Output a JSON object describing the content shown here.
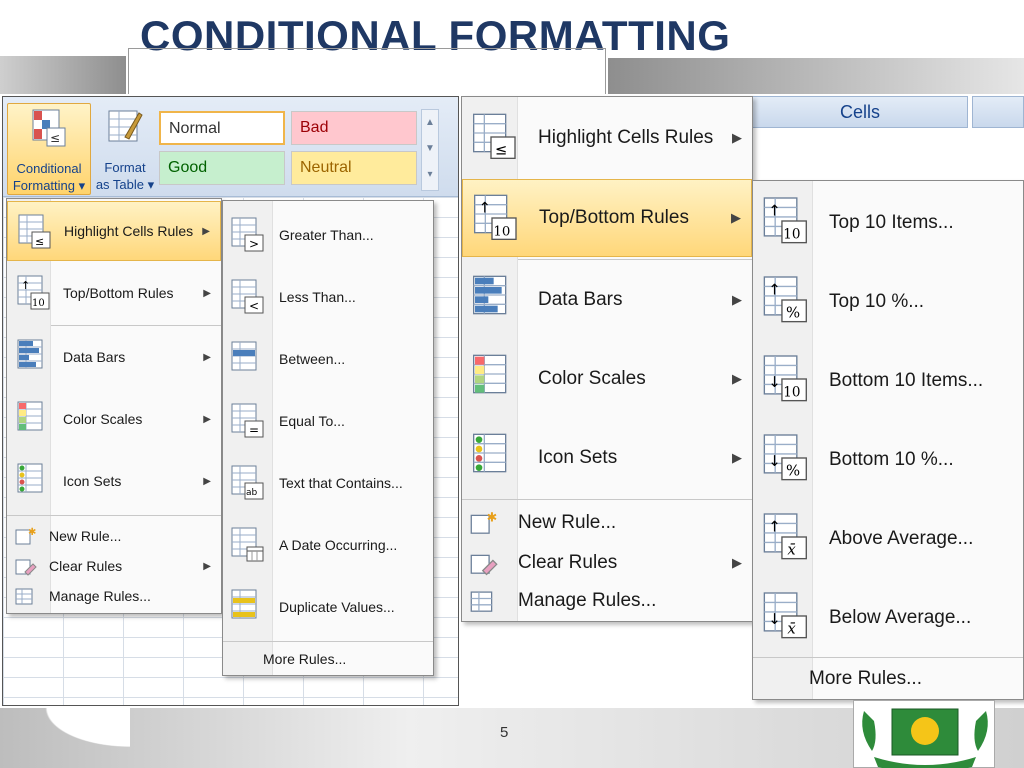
{
  "slide": {
    "title": "CONDITIONAL FORMATTING",
    "page_number": "5"
  },
  "ribbon": {
    "conditional_formatting_line1": "Conditional",
    "conditional_formatting_line2": "Formatting ▾",
    "format_as_table_line1": "Format",
    "format_as_table_line2": "as Table ▾",
    "styles": {
      "normal": "Normal",
      "bad": "Bad",
      "good": "Good",
      "neutral": "Neutral"
    },
    "cells_tab": "Cells"
  },
  "left_menu": {
    "items": [
      {
        "label": "Highlight Cells Rules",
        "icon": "highlight-cells-icon"
      },
      {
        "label": "Top/Bottom Rules",
        "icon": "top-bottom-icon"
      },
      {
        "label": "Data Bars",
        "icon": "data-bars-icon"
      },
      {
        "label": "Color Scales",
        "icon": "color-scales-icon"
      },
      {
        "label": "Icon Sets",
        "icon": "icon-sets-icon"
      }
    ],
    "small_items": [
      {
        "label": "New Rule...",
        "icon": "new-rule-icon"
      },
      {
        "label": "Clear Rules",
        "icon": "clear-rules-icon"
      },
      {
        "label": "Manage Rules...",
        "icon": "manage-rules-icon"
      }
    ]
  },
  "highlight_submenu": {
    "items": [
      {
        "label": "Greater Than...",
        "icon": "greater-than-icon"
      },
      {
        "label": "Less Than...",
        "icon": "less-than-icon"
      },
      {
        "label": "Between...",
        "icon": "between-icon"
      },
      {
        "label": "Equal To...",
        "icon": "equal-to-icon"
      },
      {
        "label": "Text that Contains...",
        "icon": "text-contains-icon"
      },
      {
        "label": "A Date Occurring...",
        "icon": "date-occurring-icon"
      },
      {
        "label": "Duplicate Values...",
        "icon": "duplicate-values-icon"
      }
    ],
    "more_rules": "More Rules..."
  },
  "right_menu": {
    "items": [
      {
        "label": "Highlight Cells Rules",
        "icon": "highlight-cells-icon"
      },
      {
        "label": "Top/Bottom Rules",
        "icon": "top-bottom-icon"
      },
      {
        "label": "Data Bars",
        "icon": "data-bars-icon"
      },
      {
        "label": "Color Scales",
        "icon": "color-scales-icon"
      },
      {
        "label": "Icon Sets",
        "icon": "icon-sets-icon"
      }
    ],
    "small_items": [
      {
        "label": "New Rule...",
        "icon": "new-rule-icon"
      },
      {
        "label": "Clear Rules",
        "icon": "clear-rules-icon"
      },
      {
        "label": "Manage Rules...",
        "icon": "manage-rules-icon"
      }
    ]
  },
  "topbottom_submenu": {
    "items": [
      {
        "label": "Top 10 Items...",
        "icon": "top-10-items-icon"
      },
      {
        "label": "Top 10 %...",
        "icon": "top-10-percent-icon"
      },
      {
        "label": "Bottom 10 Items...",
        "icon": "bottom-10-items-icon"
      },
      {
        "label": "Bottom 10 %...",
        "icon": "bottom-10-percent-icon"
      },
      {
        "label": "Above Average...",
        "icon": "above-average-icon"
      },
      {
        "label": "Below Average...",
        "icon": "below-average-icon"
      }
    ],
    "more_rules": "More Rules..."
  },
  "colors": {
    "title": "#1f3864",
    "highlight": "#ffd77a",
    "ribbon_text": "#15428b"
  }
}
